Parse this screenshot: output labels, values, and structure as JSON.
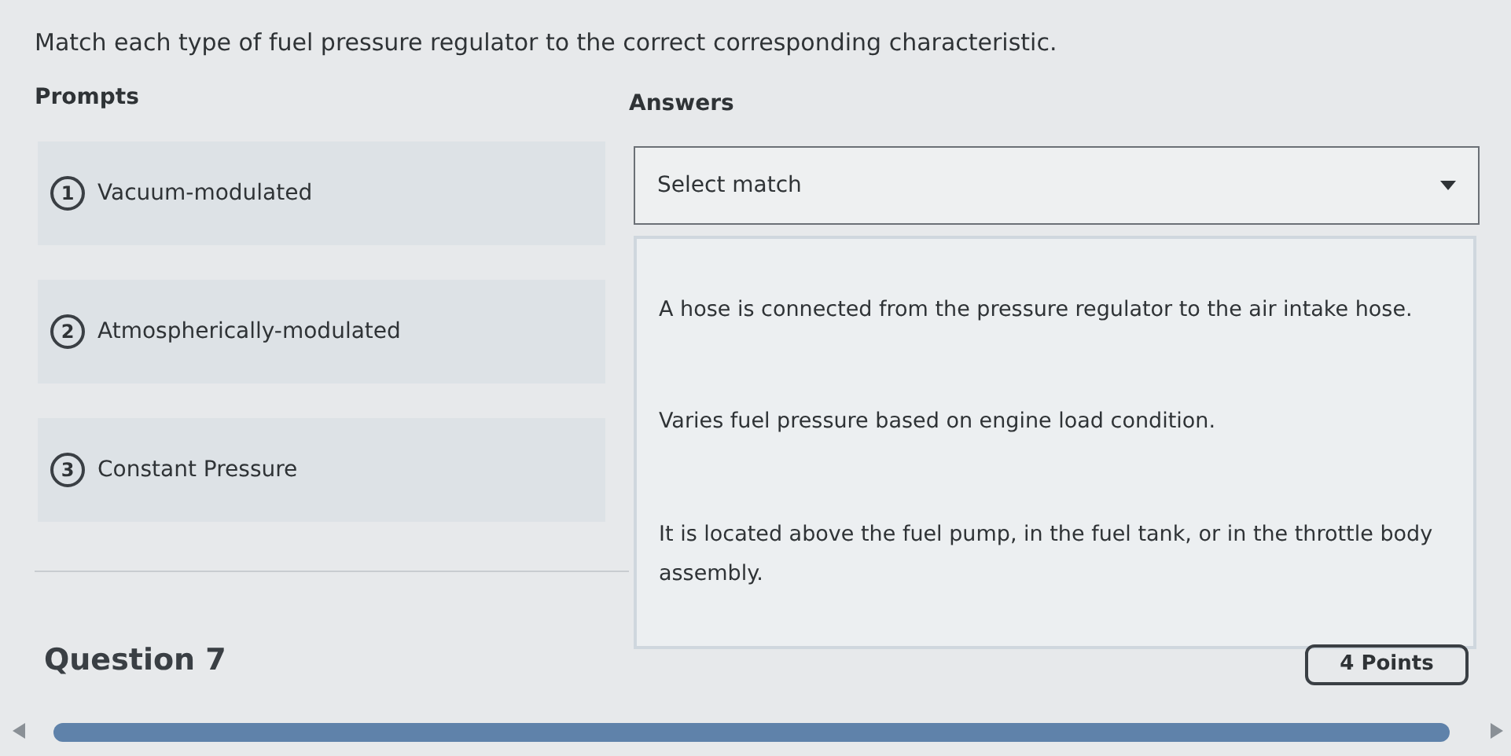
{
  "instruction": "Match each type of fuel pressure regulator to the correct corresponding characteristic.",
  "prompts_heading": "Prompts",
  "answers_heading": "Answers",
  "prompts": [
    {
      "number": "1",
      "label": "Vacuum-modulated"
    },
    {
      "number": "2",
      "label": "Atmospherically-modulated"
    },
    {
      "number": "3",
      "label": "Constant Pressure"
    }
  ],
  "select": {
    "placeholder": "Select match",
    "expanded": true
  },
  "options": [
    "A hose is connected from the pressure regulator to the air intake hose.",
    "Varies fuel pressure based on engine load condition.",
    "It is located above the fuel pump, in the fuel tank, or in the throttle body assembly."
  ],
  "next_question": {
    "title": "Question 7",
    "points": "4 Points"
  }
}
